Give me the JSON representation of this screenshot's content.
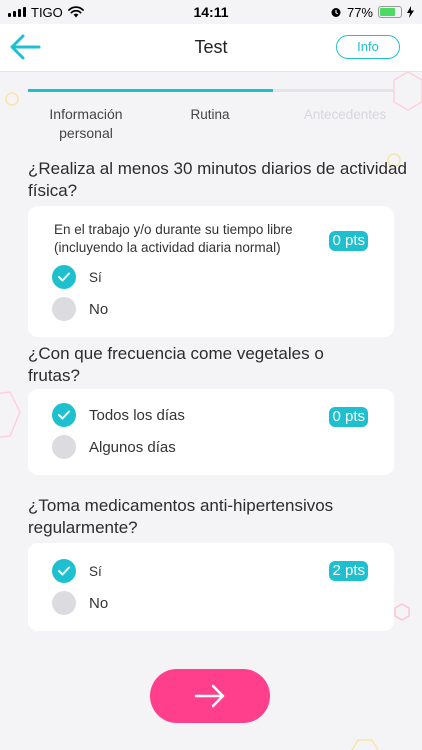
{
  "status_bar": {
    "carrier": "TIGO",
    "time": "14:11",
    "battery_percent": "77%",
    "battery_level": 0.77
  },
  "header": {
    "title": "Test",
    "info_label": "Info"
  },
  "steps": {
    "progress": 0.67,
    "items": [
      {
        "label": "Información personal",
        "state": "done"
      },
      {
        "label": "Rutina",
        "state": "current"
      },
      {
        "label": "Antecedentes",
        "state": "pending"
      }
    ]
  },
  "questions": [
    {
      "text": "¿Realiza al menos 30 minutos diarios de actividad física?",
      "description": "En el trabajo y/o durante su tiempo libre (incluyendo la actividad diaria normal)",
      "points": "0 pts",
      "options": [
        {
          "label": "Sí",
          "selected": true
        },
        {
          "label": "No",
          "selected": false
        }
      ]
    },
    {
      "text": "¿Con que frecuencia come vegetales o frutas?",
      "points": "0 pts",
      "options": [
        {
          "label": "Todos los días",
          "selected": true
        },
        {
          "label": "Algunos días",
          "selected": false
        }
      ]
    },
    {
      "text": "¿Toma medicamentos anti-hipertensivos regularmente?",
      "points": "2 pts",
      "options": [
        {
          "label": "Sí",
          "selected": true
        },
        {
          "label": "No",
          "selected": false
        }
      ]
    }
  ],
  "colors": {
    "accent": "#1ec0cf",
    "primary_button": "#ff3f8c",
    "background": "#f4f4f7",
    "unselected_radio": "#dcdce0"
  },
  "icons": {
    "back": "arrow-left-icon",
    "next": "arrow-right-icon",
    "check": "check-icon",
    "wifi": "wifi-icon",
    "alarm": "alarm-icon",
    "charging": "bolt-icon"
  }
}
